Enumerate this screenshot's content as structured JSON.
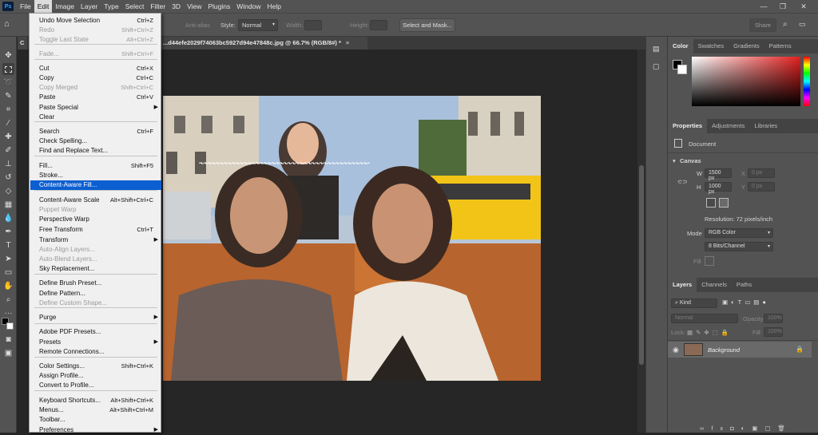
{
  "app": {
    "logo": "Ps"
  },
  "menubar": {
    "items": [
      "File",
      "Edit",
      "Image",
      "Layer",
      "Type",
      "Select",
      "Filter",
      "3D",
      "View",
      "Plugins",
      "Window",
      "Help"
    ],
    "active": "Edit",
    "window_controls": [
      "—",
      "❐",
      "✕"
    ]
  },
  "options": {
    "anti_alias": "Anti-alias",
    "style_label": "Style:",
    "style_value": "Normal",
    "width_label": "Width:",
    "height_label": "Height:",
    "select_mask": "Select and Mask...",
    "share": "Share"
  },
  "document": {
    "tab_left": "C",
    "tab_title": "...d44efe2029f74063bc5927d94e47848c.jpg @ 66.7% (RGB/8#) *",
    "close": "×"
  },
  "edit_menu": {
    "items": [
      {
        "label": "Undo Move Selection",
        "shortcut": "Ctrl+Z",
        "disabled": false
      },
      {
        "label": "Redo",
        "shortcut": "Shift+Ctrl+Z",
        "disabled": true
      },
      {
        "label": "Toggle Last State",
        "shortcut": "Alt+Ctrl+Z",
        "disabled": true
      },
      {
        "label": "Fade...",
        "shortcut": "Shift+Ctrl+F",
        "disabled": true
      },
      {
        "label": "Cut",
        "shortcut": "Ctrl+X",
        "disabled": false
      },
      {
        "label": "Copy",
        "shortcut": "Ctrl+C",
        "disabled": false
      },
      {
        "label": "Copy Merged",
        "shortcut": "Shift+Ctrl+C",
        "disabled": true
      },
      {
        "label": "Paste",
        "shortcut": "Ctrl+V",
        "disabled": false
      },
      {
        "label": "Paste Special",
        "shortcut": "",
        "disabled": false,
        "submenu": true
      },
      {
        "label": "Clear",
        "shortcut": "",
        "disabled": false
      },
      {
        "label": "Search",
        "shortcut": "Ctrl+F",
        "disabled": false
      },
      {
        "label": "Check Spelling...",
        "shortcut": "",
        "disabled": false
      },
      {
        "label": "Find and Replace Text...",
        "shortcut": "",
        "disabled": false
      },
      {
        "label": "Fill...",
        "shortcut": "Shift+F5",
        "disabled": false
      },
      {
        "label": "Stroke...",
        "shortcut": "",
        "disabled": false
      },
      {
        "label": "Content-Aware Fill...",
        "shortcut": "",
        "disabled": false,
        "highlight": true
      },
      {
        "label": "Content-Aware Scale",
        "shortcut": "Alt+Shift+Ctrl+C",
        "disabled": false
      },
      {
        "label": "Puppet Warp",
        "shortcut": "",
        "disabled": true
      },
      {
        "label": "Perspective Warp",
        "shortcut": "",
        "disabled": false
      },
      {
        "label": "Free Transform",
        "shortcut": "Ctrl+T",
        "disabled": false
      },
      {
        "label": "Transform",
        "shortcut": "",
        "disabled": false,
        "submenu": true
      },
      {
        "label": "Auto-Align Layers...",
        "shortcut": "",
        "disabled": true
      },
      {
        "label": "Auto-Blend Layers...",
        "shortcut": "",
        "disabled": true
      },
      {
        "label": "Sky Replacement...",
        "shortcut": "",
        "disabled": false
      },
      {
        "label": "Define Brush Preset...",
        "shortcut": "",
        "disabled": false
      },
      {
        "label": "Define Pattern...",
        "shortcut": "",
        "disabled": false
      },
      {
        "label": "Define Custom Shape...",
        "shortcut": "",
        "disabled": true
      },
      {
        "label": "Purge",
        "shortcut": "",
        "disabled": false,
        "submenu": true
      },
      {
        "label": "Adobe PDF Presets...",
        "shortcut": "",
        "disabled": false
      },
      {
        "label": "Presets",
        "shortcut": "",
        "disabled": false,
        "submenu": true
      },
      {
        "label": "Remote Connections...",
        "shortcut": "",
        "disabled": false
      },
      {
        "label": "Color Settings...",
        "shortcut": "Shift+Ctrl+K",
        "disabled": false
      },
      {
        "label": "Assign Profile...",
        "shortcut": "",
        "disabled": false
      },
      {
        "label": "Convert to Profile...",
        "shortcut": "",
        "disabled": false
      },
      {
        "label": "Keyboard Shortcuts...",
        "shortcut": "Alt+Shift+Ctrl+K",
        "disabled": false
      },
      {
        "label": "Menus...",
        "shortcut": "Alt+Shift+Ctrl+M",
        "disabled": false
      },
      {
        "label": "Toolbar...",
        "shortcut": "",
        "disabled": false
      },
      {
        "label": "Preferences",
        "shortcut": "",
        "disabled": false,
        "submenu": true
      }
    ]
  },
  "color_panel": {
    "tabs": [
      "Color",
      "Swatches",
      "Gradients",
      "Patterns"
    ]
  },
  "properties_panel": {
    "tabs": [
      "Properties",
      "Adjustments",
      "Libraries"
    ],
    "doc_label": "Document",
    "canvas_label": "Canvas",
    "w_label": "W",
    "w_value": "1500 px",
    "h_label": "H",
    "h_value": "1000 px",
    "x_label": "X",
    "x_value": "0 px",
    "y_label": "Y",
    "y_value": "0 px",
    "resolution": "Resolution: 72 pixels/inch",
    "mode_label": "Mode",
    "mode_value": "RGB Color",
    "bits_value": "8 Bits/Channel",
    "fill_label": "Fill"
  },
  "layers_panel": {
    "tabs": [
      "Layers",
      "Channels",
      "Paths"
    ],
    "kind": "Kind",
    "blend_mode": "Normal",
    "opacity_label": "Opacity:",
    "opacity_value": "100%",
    "lock_label": "Lock:",
    "fill_label": "Fill:",
    "fill_value": "100%",
    "layer_name": "Background"
  }
}
